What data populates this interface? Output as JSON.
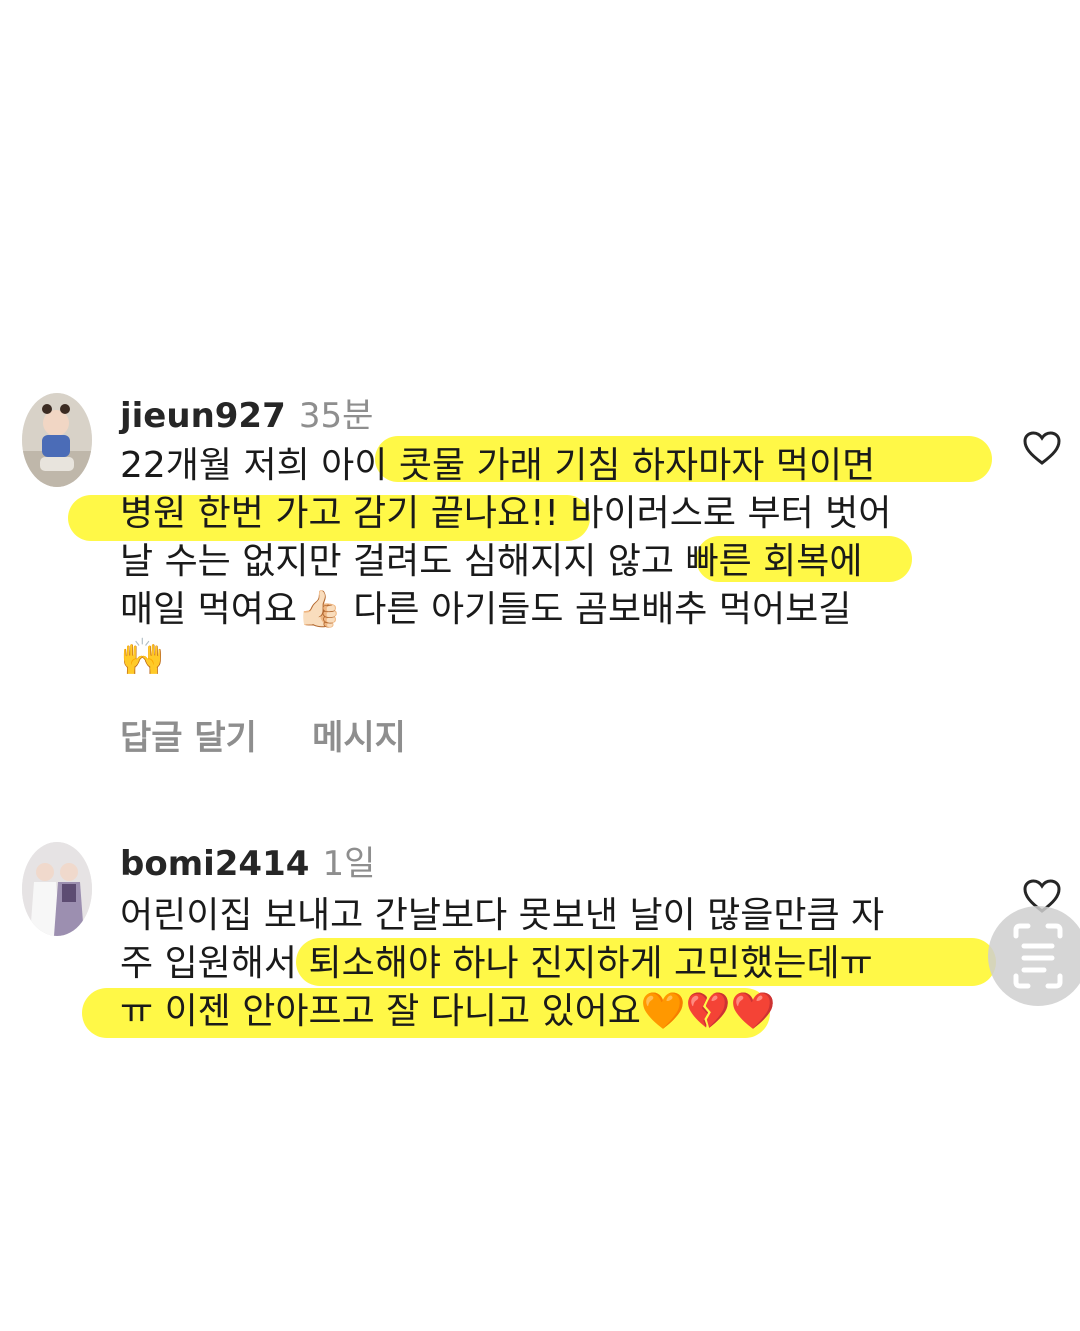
{
  "comments": [
    {
      "username": "jieun927",
      "time": "35분",
      "lines": [
        "22개월 저희 아이 콧물 가래 기침 하자마자 먹이면",
        "병원 한번 가고 감기 끝나요!! 바이러스로 부터 벗어",
        "날 수는 없지만 걸려도 심해지지 않고 빠른 회복에",
        "매일 먹여요👍🏻 다른 아기들도 곰보배추 먹어보길",
        "🙌"
      ],
      "reply_label": "답글 달기",
      "message_label": "메시지"
    },
    {
      "username": "bomi2414",
      "time": "1일",
      "lines": [
        "어린이집 보내고 간날보다 못보낸 날이 많을만큼 자",
        "주 입원해서 퇴소해야 하나 진지하게 고민했는데ㅠ",
        "ㅠ 이젠 안아프고 잘 다니고 있어요🧡💔❤️"
      ]
    }
  ],
  "icons": {
    "like": "heart-outline-icon",
    "scan": "text-scan-icon"
  },
  "colors": {
    "highlight": "#fff500",
    "username": "#262626",
    "meta": "#8e8e8e"
  }
}
